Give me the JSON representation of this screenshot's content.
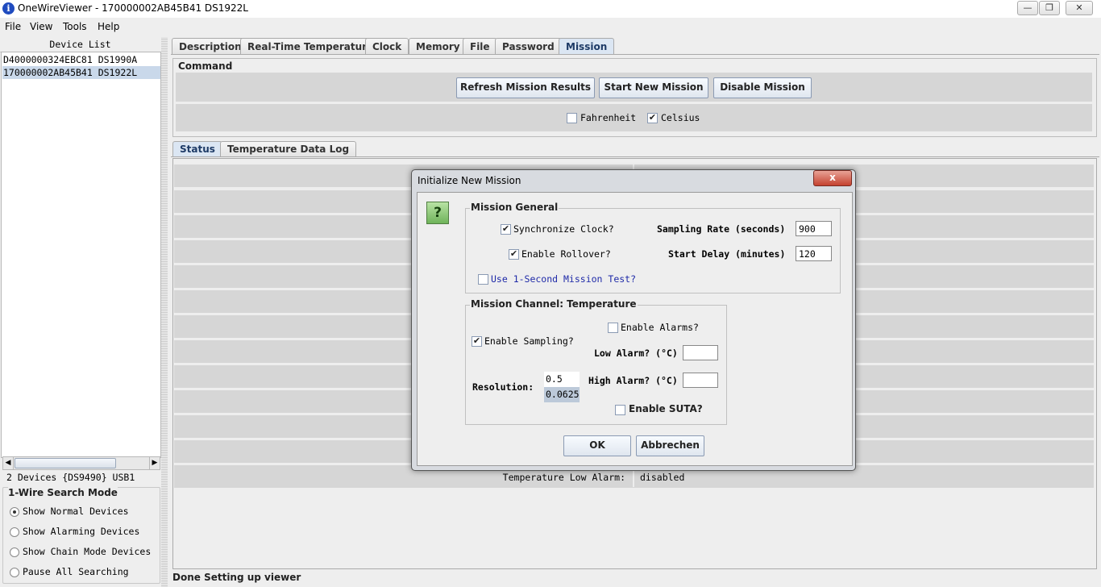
{
  "window": {
    "title": "OneWireViewer - 170000002AB45B41 DS1922L"
  },
  "menu": [
    "File",
    "View",
    "Tools",
    "Help"
  ],
  "device_list": {
    "header": "Device List",
    "items": [
      "D4000000324EBC81 DS1990A",
      "170000002AB45B41 DS1922L"
    ],
    "count_text": "2 Devices  {DS9490} USB1"
  },
  "search_mode": {
    "title": "1-Wire Search Mode",
    "options": [
      "Show Normal Devices",
      "Show Alarming Devices",
      "Show Chain Mode Devices",
      "Pause All Searching"
    ],
    "selected": 0
  },
  "tabs": [
    "Description",
    "Real-Time Temperature",
    "Clock",
    "Memory",
    "File",
    "Password",
    "Mission"
  ],
  "command": {
    "title": "Command",
    "buttons": [
      "Refresh Mission Results",
      "Start New Mission",
      "Disable Mission"
    ],
    "fahrenheit": "Fahrenheit",
    "celsius": "Celsius"
  },
  "subtabs": [
    "Status",
    "Temperature Data Log"
  ],
  "status_rows": {
    "low_alarm_label": "Temperature Low Alarm:",
    "low_alarm_value": "disabled"
  },
  "status_bar": "Done Setting up viewer",
  "dialog": {
    "title": "Initialize New Mission",
    "help_icon_text": "?",
    "close_label": "x",
    "general": {
      "title": "Mission General",
      "sync_clock": "Synchronize Clock?",
      "sampling_rate_label": "Sampling Rate (seconds)",
      "sampling_rate_value": "900",
      "rollover": "Enable Rollover?",
      "start_delay_label": "Start Delay (minutes)",
      "start_delay_value": "120",
      "one_second_test": "Use 1-Second Mission Test?"
    },
    "channel": {
      "title": "Mission Channel: Temperature",
      "enable_alarms": "Enable Alarms?",
      "enable_sampling": "Enable Sampling?",
      "low_alarm_label": "Low Alarm? (°C)",
      "high_alarm_label": "High Alarm? (°C)",
      "resolution_label": "Resolution:",
      "resolution_options": [
        "0.5",
        "0.0625"
      ],
      "suta": "Enable SUTA?"
    },
    "ok": "OK",
    "cancel": "Abbrechen"
  }
}
